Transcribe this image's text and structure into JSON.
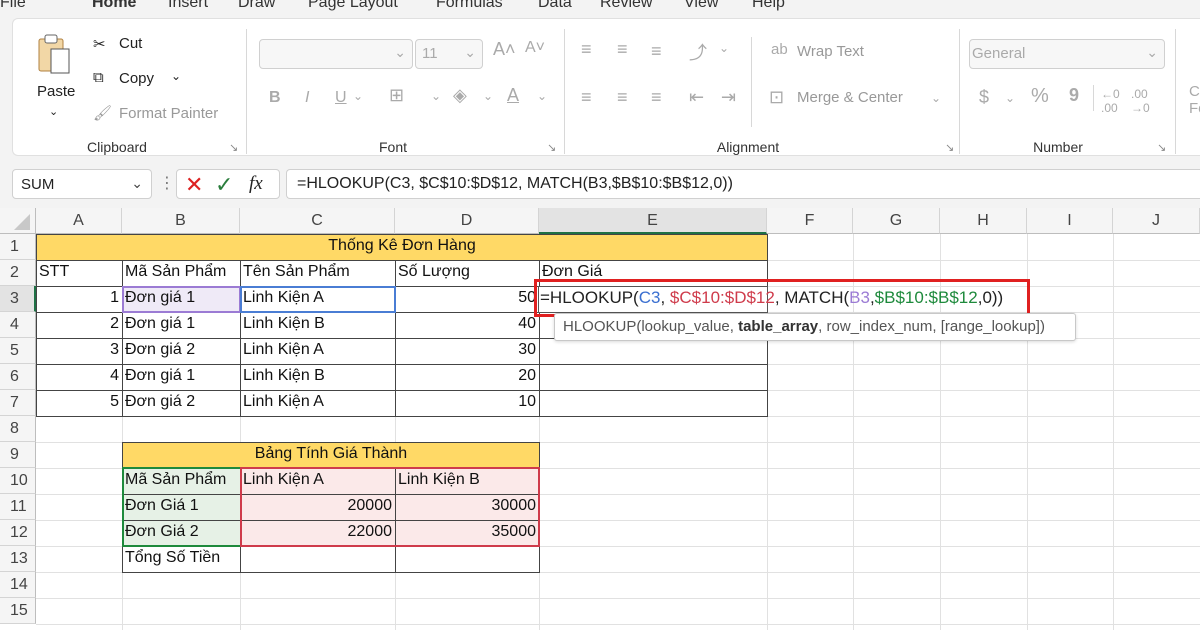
{
  "menu": {
    "tabs": [
      "File",
      "Home",
      "Insert",
      "Draw",
      "Page Layout",
      "Formulas",
      "Data",
      "Review",
      "View",
      "Help"
    ]
  },
  "clipboard": {
    "paste": "Paste",
    "cut": "Cut",
    "copy": "Copy",
    "format_painter": "Format Painter",
    "label": "Clipboard"
  },
  "font": {
    "size": "11",
    "label": "Font",
    "bold": "B",
    "italic": "I",
    "underline": "U"
  },
  "alignment": {
    "wrap_text": "Wrap Text",
    "merge_center": "Merge & Center",
    "label": "Alignment"
  },
  "number": {
    "format": "General",
    "label": "Number",
    "currency": "$",
    "percent": "%",
    "comma": "9"
  },
  "formula_bar": {
    "name_box": "SUM",
    "formula": "=HLOOKUP(C3, $C$10:$D$12, MATCH(B3,$B$10:$B$12,0))"
  },
  "columns": [
    "A",
    "B",
    "C",
    "D",
    "E",
    "F",
    "G",
    "H",
    "I",
    "J"
  ],
  "rows": [
    "1",
    "2",
    "3",
    "4",
    "5",
    "6",
    "7",
    "8",
    "9",
    "10",
    "11",
    "12",
    "13",
    "14",
    "15"
  ],
  "sheet": {
    "title1": "Thống Kê Đơn Hàng",
    "headers": [
      "STT",
      "Mã Sản Phẩm",
      "Tên Sản Phẩm",
      "Số Lượng",
      "Đơn Giá"
    ],
    "orders": [
      [
        "1",
        "Đơn giá 1",
        "Linh Kiện A",
        "50"
      ],
      [
        "2",
        "Đơn giá 1",
        "Linh Kiện B",
        "40"
      ],
      [
        "3",
        "Đơn giá 2",
        "Linh Kiện A",
        "30"
      ],
      [
        "4",
        "Đơn giá 1",
        "Linh Kiện B",
        "20"
      ],
      [
        "5",
        "Đơn giá 2",
        "Linh Kiện A",
        "10"
      ]
    ],
    "title2": "Bảng Tính Giá Thành",
    "price_header": [
      "Mã Sản Phẩm",
      "Linh Kiện A",
      "Linh Kiện B"
    ],
    "prices": [
      [
        "Đơn Giá 1",
        "20000",
        "30000"
      ],
      [
        "Đơn Giá 2",
        "22000",
        "35000"
      ]
    ],
    "total_label": "Tổng Số Tiền"
  },
  "edit_cell": {
    "f_eq": "=HLOOKUP(",
    "f_c3": "C3",
    "f_c1": ", ",
    "f_range": "$C$10:$D$12",
    "f_c2": ", MATCH(",
    "f_b3": "B3",
    "f_c4": ",",
    "f_range2": "$B$10:$B$12",
    "f_end": ",0))"
  },
  "tooltip": {
    "pre": "HLOOKUP(lookup_value, ",
    "bold": "table_array",
    "post": ", row_index_num, [range_lookup])"
  },
  "colors": {
    "title_fill": "#ffd966",
    "selected_b3": "#efeaf7",
    "green_fill": "#e6f1e6",
    "pink_fill": "#fbe9e9",
    "highlight_red": "#e02020"
  }
}
